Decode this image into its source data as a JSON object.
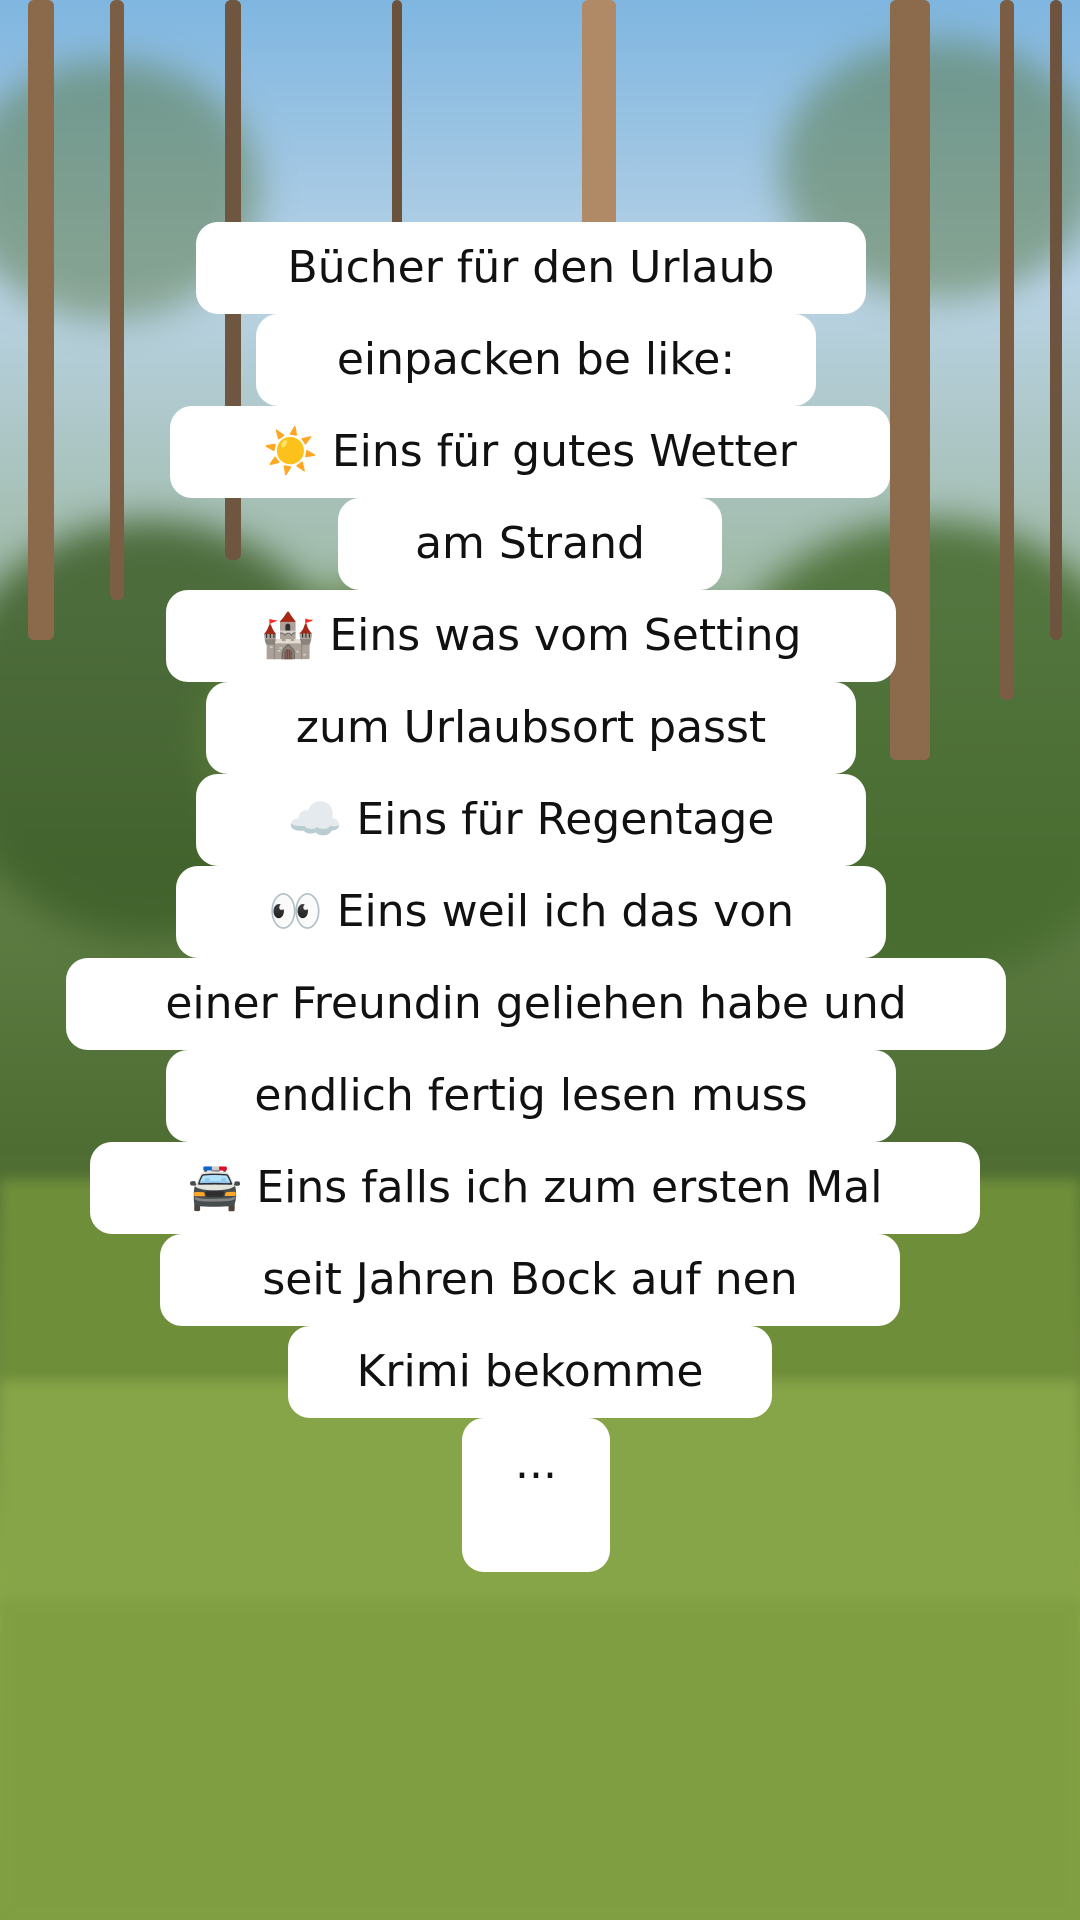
{
  "background": {
    "scene": "forest-pine-trees",
    "sky_color": "#8fc0e8",
    "foliage_color": "#4e6d33",
    "grass_color": "#8aa84a"
  },
  "caption": {
    "lines": [
      "Bücher für den Urlaub",
      "einpacken be like:",
      "☀️ Eins für gutes Wetter",
      "am Strand",
      "🏰 Eins was vom Setting",
      "zum Urlaubsort passt",
      "☁️ Eins für Regentage",
      "👀 Eins weil ich das von",
      "einer Freundin geliehen habe und",
      "endlich fertig lesen muss",
      "🚔 Eins falls ich zum ersten Mal",
      "seit Jahren Bock auf nen",
      "Krimi bekomme",
      "..."
    ]
  }
}
